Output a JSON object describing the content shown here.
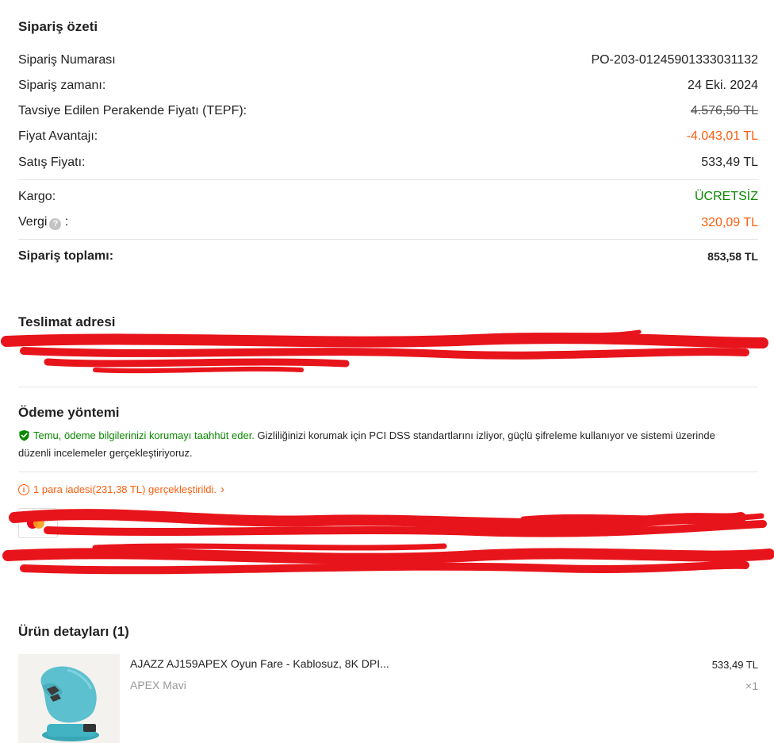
{
  "summary": {
    "title": "Sipariş özeti",
    "order_number_label": "Sipariş Numarası",
    "order_number_value": "PO-203-01245901333031132",
    "order_time_label": "Sipariş zamanı:",
    "order_time_value": "24 Eki. 2024",
    "rrp_label": "Tavsiye Edilen Perakende Fiyatı (TEPF):",
    "rrp_value": "4.576,50 TL",
    "advantage_label": "Fiyat Avantajı:",
    "advantage_value": "-4.043,01 TL",
    "sale_price_label": "Satış Fiyatı:",
    "sale_price_value": "533,49 TL",
    "shipping_label": "Kargo:",
    "shipping_value": "ÜCRETSİZ",
    "tax_label": "Vergi",
    "tax_colon": ":",
    "tax_value": "320,09 TL",
    "total_label": "Sipariş toplamı:",
    "total_value": "853,58 TL"
  },
  "delivery": {
    "title": "Teslimat adresi"
  },
  "payment": {
    "title": "Ödeme yöntemi",
    "secure_text": "Temu, ödeme bilgilerinizi korumayı taahhüt eder.",
    "privacy_text": " Gizliliğinizi korumak için PCI DSS standartlarını izliyor, güçlü şifreleme kullanıyor ve sistemi üzerinde düzenli incelemeler gerçekleştiriyoruz.",
    "refund_text": "1 para iadesi(231,38 TL) gerçekleştirildi.",
    "refund_chevron": "›"
  },
  "products": {
    "title": "Ürün detayları (1)",
    "items": [
      {
        "name": "AJAZZ AJ159APEX Oyun Fare - Kablosuz, 8K DPI...",
        "variant": "APEX Mavi",
        "price": "533,49 TL",
        "qty": "×1"
      }
    ]
  },
  "colors": {
    "accent_orange": "#fb5e0e",
    "success_green": "#0a8800",
    "redaction_red": "#e8141b",
    "product_blue": "#4fb8c8"
  },
  "icons": {
    "tax_help": "question-circle-icon",
    "secure": "shield-check-icon",
    "refund_info": "info-circle-icon",
    "card": "mastercard-icon"
  }
}
